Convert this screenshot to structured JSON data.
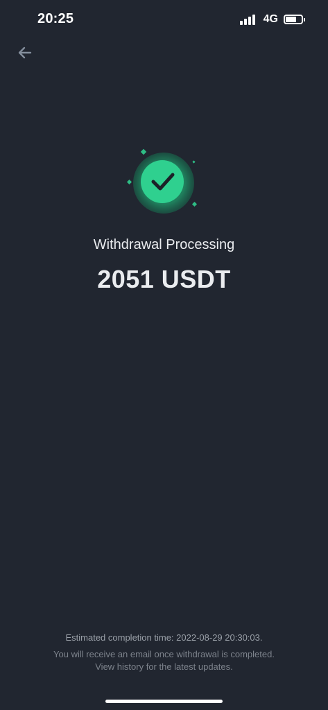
{
  "status_bar": {
    "time": "20:25",
    "network": "4G",
    "battery_level": 0.7
  },
  "header": {
    "back_icon": "arrow-left-icon"
  },
  "success": {
    "icon": "check-circle-icon",
    "accent": "#2ebd85",
    "title": "Withdrawal Processing",
    "amount": "2051 USDT"
  },
  "footer": {
    "estimate": "Estimated completion time: 2022-08-29 20:30:03.",
    "note_line1": "You will receive an email once withdrawal is completed.",
    "note_line2": "View history for the latest updates."
  },
  "colors": {
    "background": "#212630",
    "text_primary": "#eaecef",
    "text_secondary": "#9aa0a8"
  }
}
